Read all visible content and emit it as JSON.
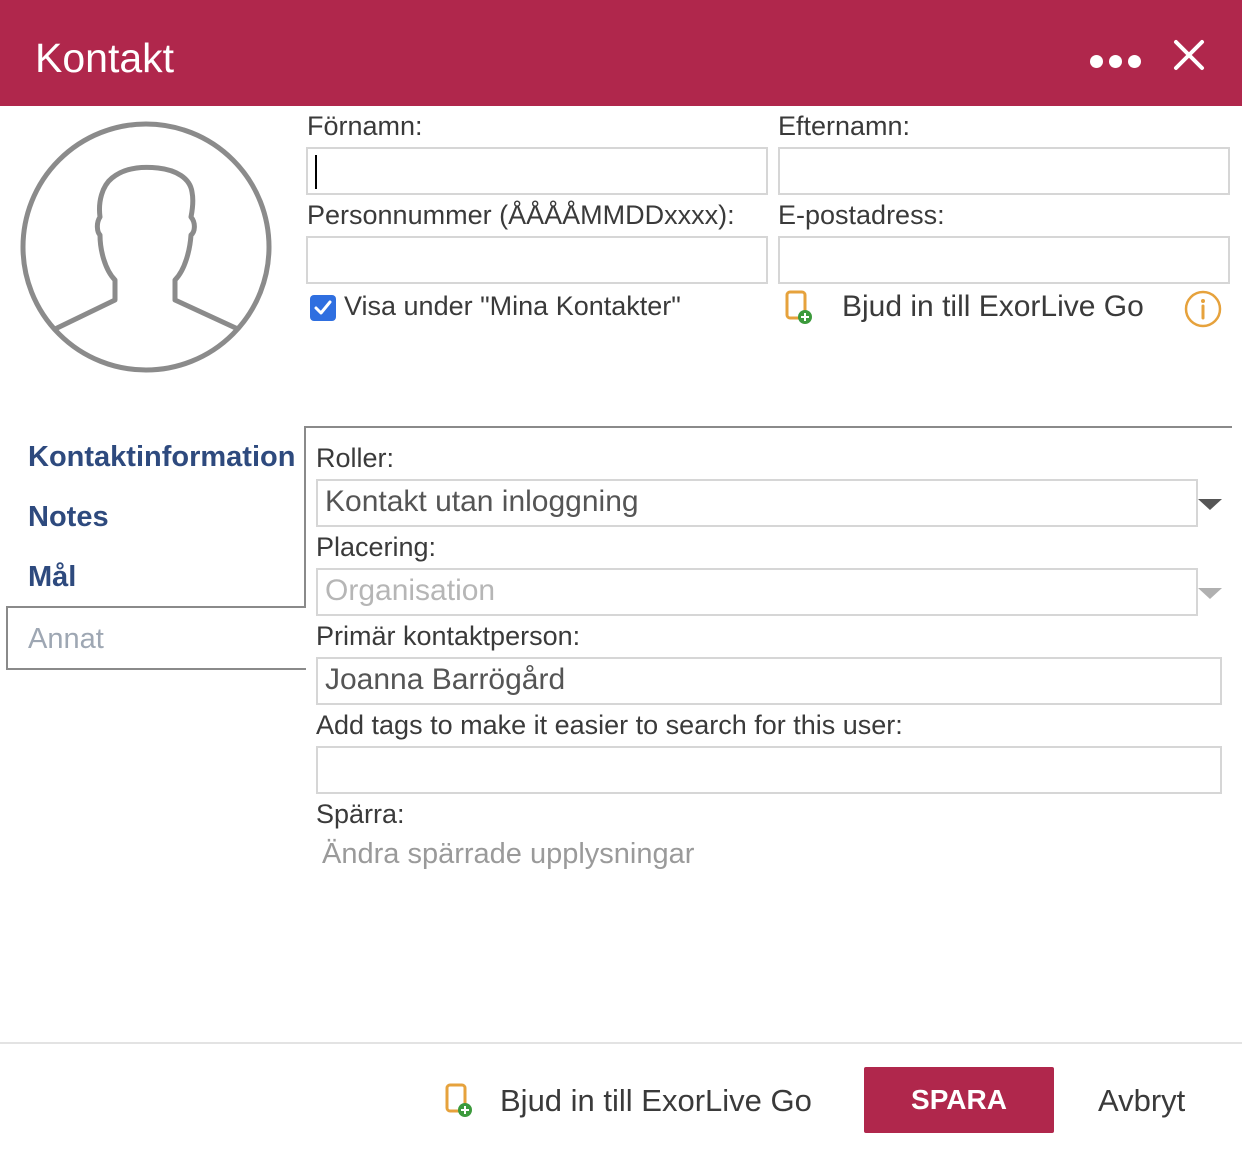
{
  "header": {
    "title": "Kontakt"
  },
  "form": {
    "first_name_label": "Förnamn:",
    "first_name_value": "",
    "last_name_label": "Efternamn:",
    "last_name_value": "",
    "ssn_label": "Personnummer (ÅÅÅÅMMDDxxxx):",
    "ssn_value": "",
    "email_label": "E-postadress:",
    "email_value": "",
    "show_in_contacts_label": "Visa under \"Mina Kontakter\"",
    "show_in_contacts_checked": true,
    "invite_label": "Bjud in till ExorLive Go"
  },
  "tabs": [
    {
      "label": "Kontaktinformation"
    },
    {
      "label": "Notes"
    },
    {
      "label": "Mål"
    },
    {
      "label": "Annat",
      "active": true
    }
  ],
  "other": {
    "roles_label": "Roller:",
    "roles_value": "Kontakt utan inloggning",
    "placement_label": "Placering:",
    "placement_value": "Organisation",
    "primary_contact_label": "Primär kontaktperson:",
    "primary_contact_value": "Joanna Barrögård",
    "tags_label": "Add tags to make it easier to search for this user:",
    "tags_value": "",
    "lock_label": "Spärra:",
    "lock_link": "Ändra spärrade upplysningar"
  },
  "footer": {
    "invite_label": "Bjud in till ExorLive Go",
    "save_label": "SPARA",
    "cancel_label": "Avbryt"
  },
  "colors": {
    "brand": "#b0274c",
    "checkbox": "#2f6fe0",
    "tab_text": "#2e4a7e",
    "info": "#e6a23c",
    "invite_plus": "#3c9a3c"
  },
  "icons": [
    "more-icon",
    "close-icon",
    "avatar-icon",
    "invite-icon",
    "info-icon",
    "chevron-down-icon",
    "checkbox-check-icon"
  ]
}
